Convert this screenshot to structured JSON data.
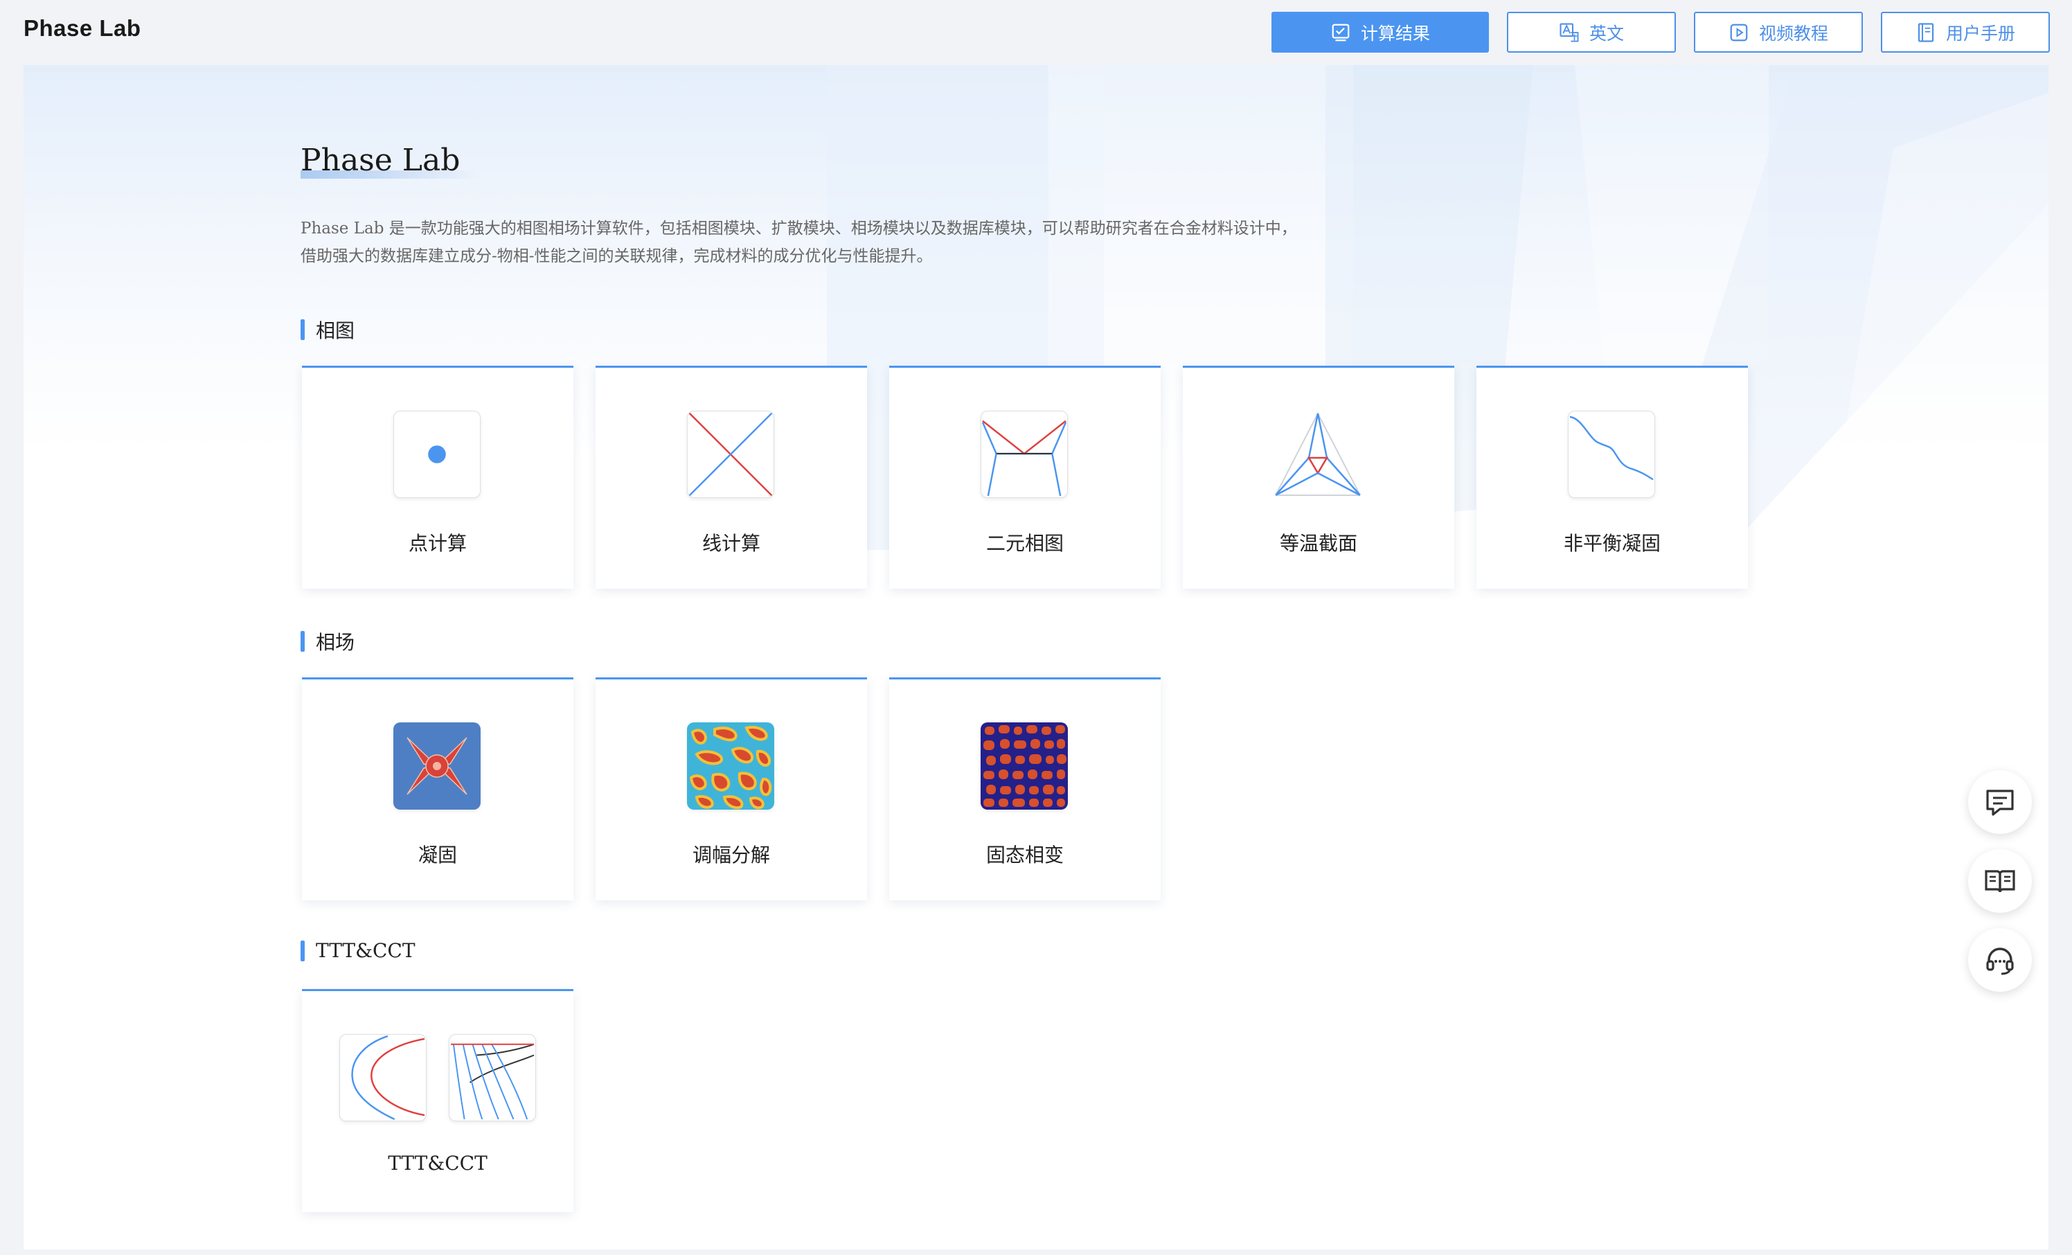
{
  "app": {
    "title": "Phase Lab"
  },
  "topbar": {
    "buttons": [
      {
        "label": "计算结果",
        "icon": "checklist-icon"
      },
      {
        "label": "英文",
        "icon": "translate-icon"
      },
      {
        "label": "视频教程",
        "icon": "video-icon"
      },
      {
        "label": "用户手册",
        "icon": "book-icon"
      }
    ]
  },
  "hero": {
    "title": "Phase Lab",
    "desc_line1": "Phase Lab 是一款功能强大的相图相场计算软件，包括相图模块、扩散模块、相场模块以及数据库模块，可以帮助研究者在合金材料设计中，",
    "desc_line2": "借助强大的数据库建立成分-物相-性能之间的关联规律，完成材料的成分优化与性能提升。"
  },
  "sections": [
    {
      "title": "相图",
      "cards": [
        {
          "label": "点计算",
          "icon": "point-calc-icon"
        },
        {
          "label": "线计算",
          "icon": "line-calc-icon"
        },
        {
          "label": "二元相图",
          "icon": "binary-diagram-icon"
        },
        {
          "label": "等温截面",
          "icon": "isothermal-section-icon"
        },
        {
          "label": "非平衡凝固",
          "icon": "nonequilibrium-solidification-icon"
        }
      ]
    },
    {
      "title": "相场",
      "cards": [
        {
          "label": "凝固",
          "icon": "dendrite-icon"
        },
        {
          "label": "调幅分解",
          "icon": "spinodal-icon"
        },
        {
          "label": "固态相变",
          "icon": "solid-transformation-icon"
        }
      ]
    },
    {
      "title": "TTT&CCT",
      "cards": [
        {
          "label": "TTT&CCT",
          "icon": "ttt-cct-icon"
        }
      ]
    }
  ],
  "floating": [
    {
      "icon": "message-icon"
    },
    {
      "icon": "manual-icon"
    },
    {
      "icon": "support-headset-icon"
    }
  ],
  "colors": {
    "accent": "#4b95f1",
    "line_red": "#e04040",
    "line_blue": "#4b95f1"
  }
}
